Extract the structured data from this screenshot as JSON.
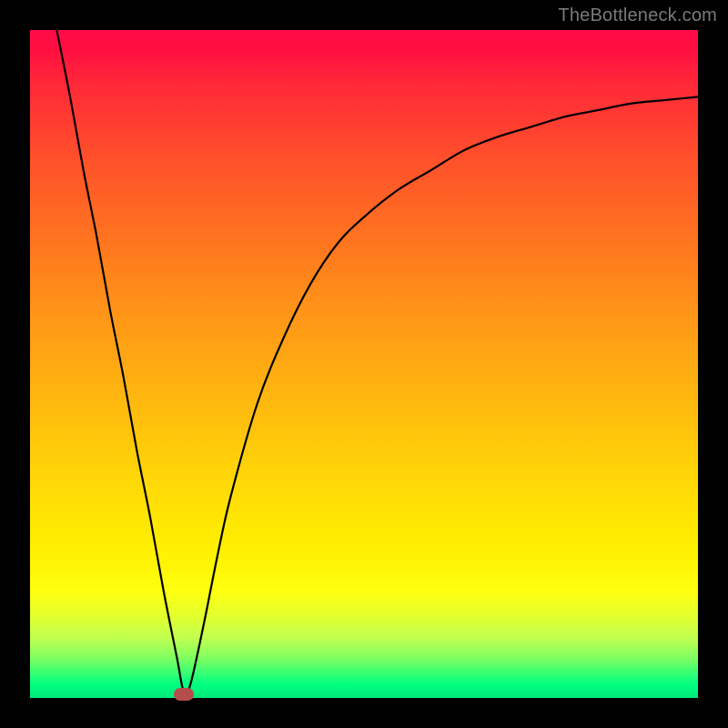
{
  "attribution": "TheBottleneck.com",
  "colors": {
    "page_bg": "#000000",
    "gradient_top": "#ff0a4a",
    "gradient_bottom": "#00e878",
    "curve": "#000000",
    "marker": "#b54d4d",
    "attribution_text": "#7a7a7a"
  },
  "chart_data": {
    "type": "line",
    "title": "",
    "xlabel": "",
    "ylabel": "",
    "xlim": [
      0,
      100
    ],
    "ylim": [
      0,
      100
    ],
    "grid": false,
    "legend": false,
    "series": [
      {
        "name": "bottleneck-curve",
        "x": [
          4,
          6,
          8,
          10,
          12,
          14,
          16,
          18,
          20,
          22,
          23,
          24,
          26,
          28,
          30,
          34,
          38,
          42,
          46,
          50,
          55,
          60,
          65,
          70,
          75,
          80,
          85,
          90,
          95,
          100
        ],
        "y": [
          100,
          90,
          79,
          69,
          58,
          48,
          37,
          27,
          16,
          6,
          1,
          2,
          11,
          21,
          30,
          44,
          54,
          62,
          68,
          72,
          76,
          79,
          82,
          84,
          85.5,
          87,
          88,
          89,
          89.5,
          90
        ]
      }
    ],
    "marker": {
      "x": 23,
      "y": 0.5
    },
    "notes": "Background is a vertical red→yellow→green gradient. Curve drops steeply from top-left to a minimum near x≈23, then rises asymptotically toward ~90 on the right. Values estimated from pixel positions; no numeric tick labels present in source image."
  }
}
